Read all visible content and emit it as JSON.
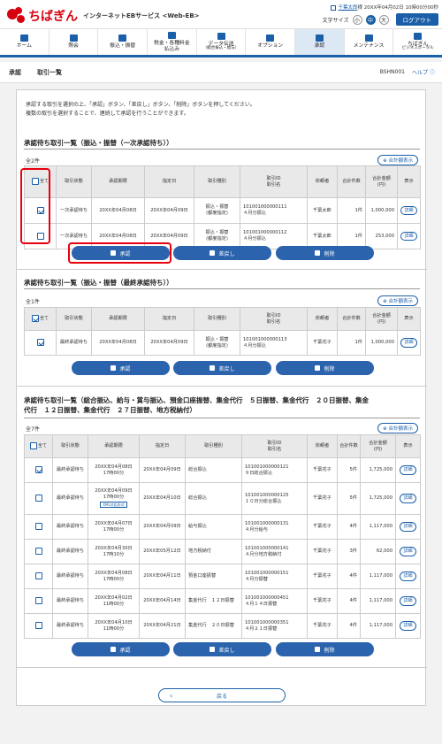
{
  "header": {
    "brand": "ちばぎん",
    "service": "インターネットEBサービス <Web-EB>",
    "user_name": "千葉太郎",
    "user_suffix": "様",
    "last_login": "20XX年04月02日 10時00分00秒",
    "font_size_label": "文字サイズ",
    "font_sizes": [
      "小",
      "中",
      "大"
    ],
    "logout": "ログアウト"
  },
  "nav": [
    {
      "label": "ホーム",
      "sub": "",
      "icon": "home-icon"
    },
    {
      "label": "照会",
      "sub": "",
      "icon": "inquiry-icon"
    },
    {
      "label": "振込・振替",
      "sub": "",
      "icon": "transfer-icon"
    },
    {
      "label": "税金・各種料金",
      "sub": "払込み",
      "icon": "tax-icon"
    },
    {
      "label": "データ伝送",
      "sub": "（総合振込・給与）",
      "icon": "data-transfer-icon"
    },
    {
      "label": "オプション",
      "sub": "",
      "icon": "option-icon"
    },
    {
      "label": "承認",
      "sub": "",
      "icon": "approval-icon"
    },
    {
      "label": "メンテナンス",
      "sub": "",
      "icon": "maintenance-icon"
    },
    {
      "label": "ちばぎん",
      "sub": "ビジネスポータル",
      "icon": "portal-icon"
    }
  ],
  "titlebar": {
    "title": "承認",
    "subtitle": "取引一覧",
    "screen_id": "BSHN001",
    "help": "ヘルプ"
  },
  "intro": {
    "line1": "承認する取引を選択の上、「承認」ボタン、「差戻し」ボタン、「削除」ボタンを押してください。",
    "line2": "複数の取引を選択することで、連続して承認を行うことができます。"
  },
  "buttons": {
    "approve": "承認",
    "return": "差戻し",
    "delete": "削除",
    "back": "戻る",
    "total": "合計額表示",
    "detail": "詳細",
    "all": "全て"
  },
  "columns": {
    "status": "取引状態",
    "deadline": "承認期限",
    "date": "指定日",
    "type": "取引種別",
    "id_name": "取引ID\n取引名",
    "requester": "依頼者",
    "count": "合計件数",
    "amount": "合計金額\n(円)",
    "view": "表示"
  },
  "section1": {
    "title": "承認待ち取引一覧（振込・振替（一次承認待ち））",
    "count": "全2件",
    "rows": [
      {
        "checked": true,
        "status": "一次承認待ち",
        "deadline": "20XX年04月08日",
        "date": "20XX年04月09日",
        "type": "振込・振替\n(都度指定)",
        "id": "101001000000111",
        "name": "４月分振込",
        "requester": "千葉太郎",
        "count": "1件",
        "amount": "1,000,000"
      },
      {
        "checked": false,
        "status": "一次承認待ち",
        "deadline": "20XX年04月08日",
        "date": "20XX年04月09日",
        "type": "振込・振替\n(都度指定)",
        "id": "101001000000112",
        "name": "４月分振込",
        "requester": "千葉太郎",
        "count": "1件",
        "amount": "253,000"
      }
    ]
  },
  "section2": {
    "title": "承認待ち取引一覧（振込・振替（最終承認待ち））",
    "count": "全1件",
    "rows": [
      {
        "checked": true,
        "status": "最終承認待ち",
        "deadline": "20XX年04月08日",
        "date": "20XX年04月09日",
        "type": "振込・振替\n(都度指定)",
        "id": "101001000000113",
        "name": "４月分振込",
        "requester": "千葉花子",
        "count": "1件",
        "amount": "1,000,000"
      }
    ]
  },
  "section3": {
    "title_line1": "承認待ち取引一覧（総合振込、給与・賞与振込、預金口座振替、集金代行　５日振替、集金代行　２０日振替、集金",
    "title_line2": "代行　１２日振替、集金代行　２７日振替、地方税納付）",
    "count": "全7件",
    "rows": [
      {
        "checked": true,
        "status": "最終承認待ち",
        "deadline": "20XX年04月08日\n17時00分",
        "tag": "",
        "date": "20XX年04月09日",
        "type": "総合振込",
        "id": "101001000000121",
        "name": "９日総合振込",
        "requester": "千葉花子",
        "count": "5件",
        "amount": "1,725,000"
      },
      {
        "checked": false,
        "status": "最終承認待ち",
        "deadline": "20XX年04月09日\n17時00分",
        "tag": "XML対応形式",
        "date": "20XX年04月10日",
        "type": "総合振込",
        "id": "101001000000125",
        "name": "１０日分総合振込",
        "requester": "千葉花子",
        "count": "5件",
        "amount": "1,725,000"
      },
      {
        "checked": false,
        "status": "最終承認待ち",
        "deadline": "20XX年04月07日\n17時00分",
        "tag": "",
        "date": "20XX年04月09日",
        "type": "給与振込",
        "id": "101001000000131",
        "name": "４月分給与",
        "requester": "千葉花子",
        "count": "4件",
        "amount": "1,117,000"
      },
      {
        "checked": false,
        "status": "最終承認待ち",
        "deadline": "20XX年04月30日\n17時10分",
        "tag": "",
        "date": "20XX年05月12日",
        "type": "地方税納付",
        "id": "101001000000141",
        "name": "４月分地方税納付",
        "requester": "千葉花子",
        "count": "3件",
        "amount": "62,000"
      },
      {
        "checked": false,
        "status": "最終承認待ち",
        "deadline": "20XX年04月08日\n17時00分",
        "tag": "",
        "date": "20XX年04月11日",
        "type": "預金口座振替",
        "id": "101001000000151",
        "name": "４月分振替",
        "requester": "千葉花子",
        "count": "4件",
        "amount": "1,117,000"
      },
      {
        "checked": false,
        "status": "最終承認待ち",
        "deadline": "20XX年04月02日\n11時00分",
        "tag": "",
        "date": "20XX年04月14日",
        "type": "集金代行　１２日振替",
        "id": "101001000000451",
        "name": "４月１４日振替",
        "requester": "千葉花子",
        "count": "4件",
        "amount": "1,117,000"
      },
      {
        "checked": false,
        "status": "最終承認待ち",
        "deadline": "20XX年04月10日\n11時00分",
        "tag": "",
        "date": "20XX年04月21日",
        "type": "集金代行　２０日振替",
        "id": "101001000000351",
        "name": "４月２１日振替",
        "requester": "千葉花子",
        "count": "4件",
        "amount": "1,117,000"
      }
    ]
  },
  "colors": {
    "brand_red": "#d7000f",
    "primary_blue": "#2b63ad",
    "highlight": "#e8000e"
  }
}
